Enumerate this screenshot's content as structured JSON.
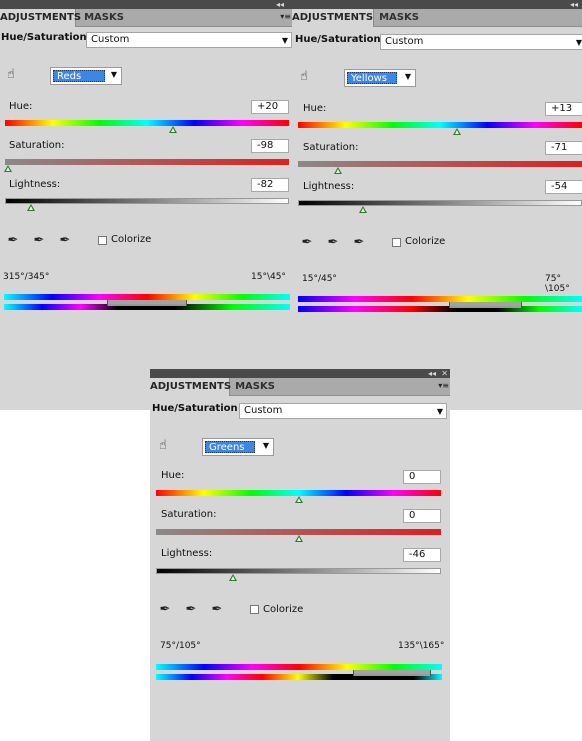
{
  "panels": [
    {
      "tabs": {
        "adjustments": "ADJUSTMENTS",
        "masks": "MASKS"
      },
      "title": "Hue/Saturation",
      "preset": "Custom",
      "channel": "Reds",
      "hue": {
        "label": "Hue:",
        "value": "+20",
        "slider": 0.59
      },
      "saturation": {
        "label": "Saturation:",
        "value": "-98",
        "slider": 0.01
      },
      "lightness": {
        "label": "Lightness:",
        "value": "-82",
        "slider": 0.09
      },
      "colorize": "Colorize",
      "range_left": "315°/345°",
      "range_right": "15°\\45°",
      "range_fractions": [
        0.36,
        0.64
      ]
    },
    {
      "tabs": {
        "adjustments": "ADJUSTMENTS",
        "masks": "MASKS"
      },
      "title": "Hue/Saturation",
      "preset": "Custom",
      "channel": "Yellows",
      "hue": {
        "label": "Hue:",
        "value": "+13",
        "slider": 0.56
      },
      "saturation": {
        "label": "Saturation:",
        "value": "-71",
        "slider": 0.14
      },
      "lightness": {
        "label": "Lightness:",
        "value": "-54",
        "slider": 0.23
      },
      "colorize": "Colorize",
      "range_left": "15°/45°",
      "range_right": "75°\\105°",
      "range_fractions": [
        0.53,
        0.79
      ]
    },
    {
      "tabs": {
        "adjustments": "ADJUSTMENTS",
        "masks": "MASKS"
      },
      "title": "Hue/Saturation",
      "preset": "Custom",
      "channel": "Greens",
      "hue": {
        "label": "Hue:",
        "value": "0",
        "slider": 0.5
      },
      "saturation": {
        "label": "Saturation:",
        "value": "0",
        "slider": 0.5
      },
      "lightness": {
        "label": "Lightness:",
        "value": "-46",
        "slider": 0.27
      },
      "colorize": "Colorize",
      "range_left": "75°/105°",
      "range_right": "135°\\165°",
      "range_fractions": [
        0.69,
        0.96
      ]
    }
  ]
}
